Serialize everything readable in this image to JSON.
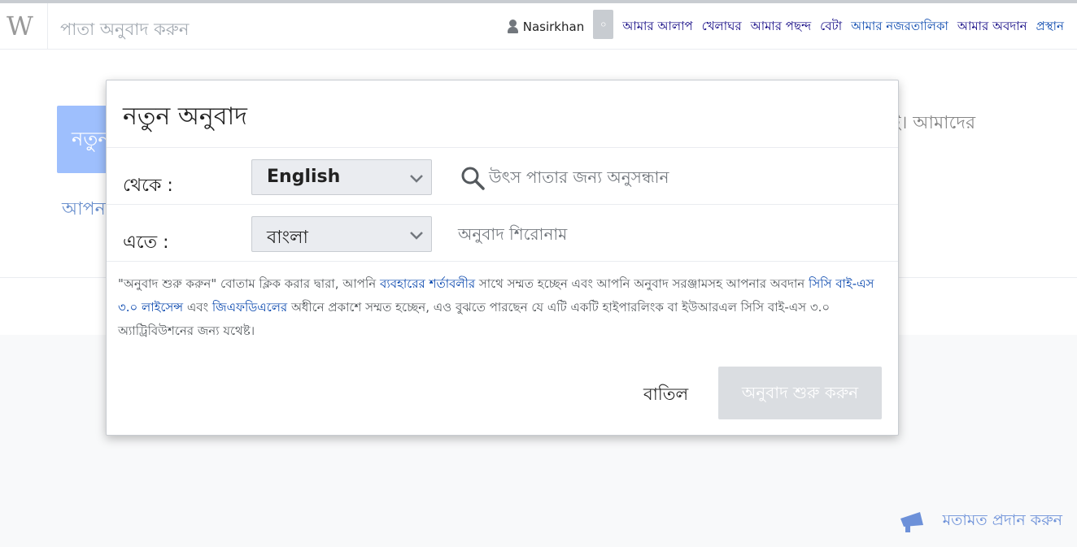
{
  "header": {
    "logo": "W",
    "page_title": "পাতা অনুবাদ করুন",
    "username": "Nasirkhan",
    "notifications_count": "০",
    "links": [
      "আমার আলাপ",
      "খেলাঘর",
      "আমার পছন্দ",
      "বেটা",
      "আমার নজরতালিকা",
      "আমার অবদান",
      "প্রস্থান"
    ]
  },
  "background": {
    "button_text": "নতুন",
    "link_text": "আপন",
    "right_text": "ই। আমাদের",
    "feedback": "মতামত প্রদান করুন"
  },
  "dialog": {
    "title": "নতুন অনুবাদ",
    "from_label": "থেকে :",
    "from_language": "English",
    "search_placeholder": "উৎস পাতার জন্য অনুসন্ধান",
    "to_label": "এতে :",
    "to_language": "বাংলা",
    "title_placeholder": "অনুবাদ শিরোনাম",
    "terms": {
      "part1": "\"অনুবাদ শুরু করুন\" বোতাম ক্লিক করার দ্বারা, আপনি ",
      "link1": "ব্যবহারের শর্তাবলীর",
      "part2": " সাথে সম্মত হচ্ছেন এবং আপনি অনুবাদ সরঞ্জামসহ আপনার অবদান ",
      "link2": "সিসি বাই-এস ৩.০ লাইসেন্স",
      "part3": " এবং ",
      "link3": "জিএফডিএলের",
      "part4": " অধীনে প্রকাশে সম্মত হচ্ছেন, এও বুঝতে পারছেন যে এটি একটি হাইপারলিংক বা ইউআরএল সিসি বাই-এস ৩.০ অ্যাট্রিবিউশনের জন্য যথেষ্ট।"
    },
    "cancel": "বাতিল",
    "start": "অনুবাদ শুরু করুন"
  }
}
